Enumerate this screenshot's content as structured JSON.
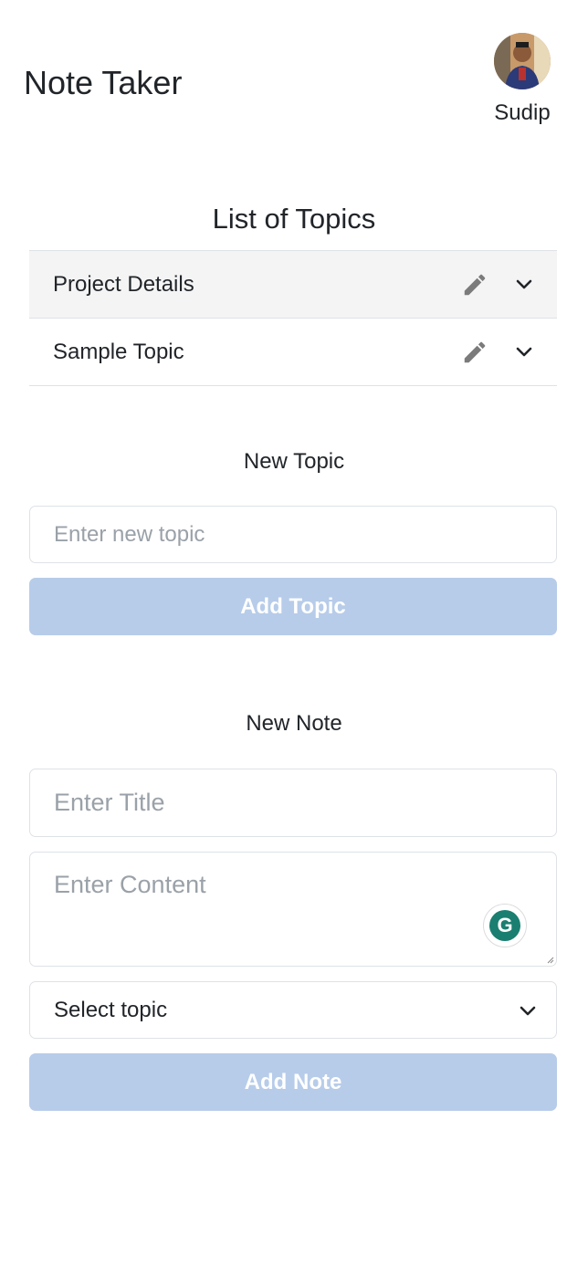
{
  "header": {
    "title": "Note Taker",
    "user_name": "Sudip"
  },
  "topics": {
    "title": "List of Topics",
    "items": [
      {
        "label": "Project Details",
        "active": true
      },
      {
        "label": "Sample Topic",
        "active": false
      }
    ]
  },
  "new_topic": {
    "title": "New Topic",
    "input_placeholder": "Enter new topic",
    "button_label": "Add Topic"
  },
  "new_note": {
    "title": "New Note",
    "title_placeholder": "Enter Title",
    "content_placeholder": "Enter Content",
    "select_value": "Select topic",
    "button_label": "Add Note"
  },
  "colors": {
    "button_disabled": "#b7cce9",
    "grammarly": "#1a7f70"
  },
  "icons": [
    "avatar",
    "pencil-icon",
    "chevron-down-icon",
    "grammarly-icon"
  ]
}
